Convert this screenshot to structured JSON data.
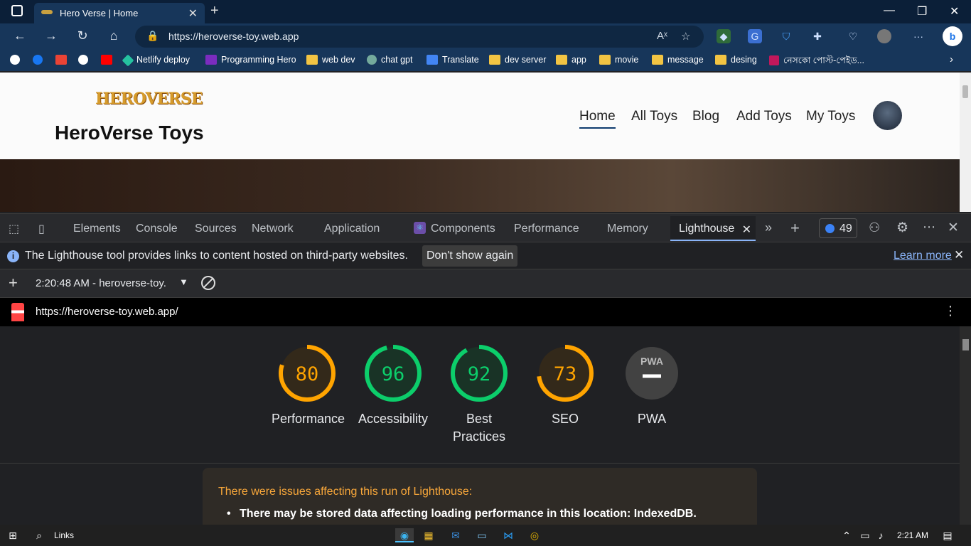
{
  "browser": {
    "tab_title": "Hero Verse | Home",
    "url": "https://heroverse-toy.web.app",
    "bookmarks": [
      "Netlify deploy",
      "Programming Hero",
      "web dev",
      "chat gpt",
      "Translate",
      "dev server",
      "app",
      "movie",
      "message",
      "desing",
      "নেসকো পোস্ট-পেইড..."
    ]
  },
  "site": {
    "logo": "HEROVERSE",
    "title": "HeroVerse Toys",
    "nav": [
      "Home",
      "All Toys",
      "Blog",
      "Add Toys",
      "My Toys"
    ]
  },
  "devtools": {
    "tabs": [
      "Elements",
      "Console",
      "Sources",
      "Network",
      "Application",
      "Components",
      "Performance",
      "Memory"
    ],
    "active_tab": "Lighthouse",
    "issues_count": "49",
    "info_text": "The Lighthouse tool provides links to content hosted on third-party websites.",
    "dont_show": "Don't show again",
    "learn_more": "Learn more",
    "report_select": "2:20:48 AM - heroverse-toy.​",
    "report_url": "https://heroverse-toy.web.app/"
  },
  "scores": [
    {
      "label": "Performance",
      "value": 80,
      "color": "#ffa400",
      "bg": "#33291a"
    },
    {
      "label": "Accessibility",
      "value": 96,
      "color": "#0cce6b",
      "bg": "#193326"
    },
    {
      "label": "Best Practices",
      "value": 92,
      "color": "#0cce6b",
      "bg": "#193326"
    },
    {
      "label": "SEO",
      "value": 73,
      "color": "#ffa400",
      "bg": "#33291a"
    },
    {
      "label": "PWA",
      "value": "PWA",
      "color": "#9e9e9e",
      "bg": "#424242"
    }
  ],
  "warning": {
    "title": "There were issues affecting this run of Lighthouse:",
    "item": "There may be stored data affecting loading performance in this location: IndexedDB."
  },
  "taskbar": {
    "search": "Links",
    "time": "2:21 AM"
  }
}
